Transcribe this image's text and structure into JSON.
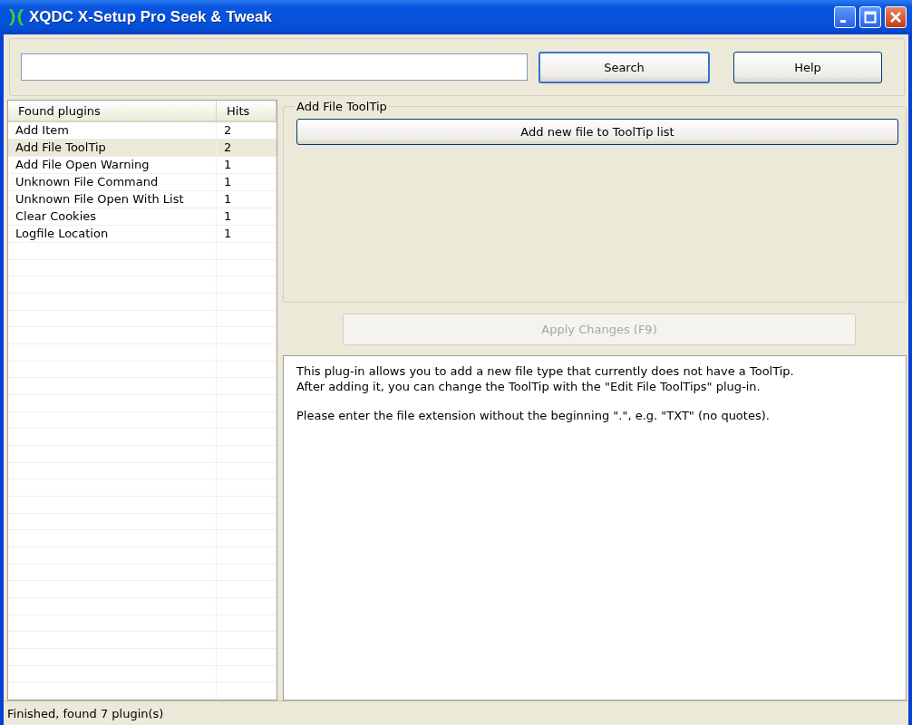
{
  "window": {
    "title": "XQDC X-Setup Pro Seek & Tweak"
  },
  "buttons": [
    {
      "label": "Search",
      "default": true
    },
    {
      "label": "Help",
      "default": false
    }
  ],
  "list": {
    "columns": [
      "Found plugins",
      "Hits"
    ],
    "rows": [
      {
        "name": "Add Item",
        "hits": "2",
        "selected": false
      },
      {
        "name": "Add File ToolTip",
        "hits": "2",
        "selected": true
      },
      {
        "name": "Add File Open Warning",
        "hits": "1",
        "selected": false
      },
      {
        "name": "Unknown File Command",
        "hits": "1",
        "selected": false
      },
      {
        "name": "Unknown File Open With List",
        "hits": "1",
        "selected": false
      },
      {
        "name": "Clear Cookies",
        "hits": "1",
        "selected": false
      },
      {
        "name": "Logfile Location",
        "hits": "1",
        "selected": false
      }
    ]
  },
  "plugin_group": {
    "title": "Add File ToolTip",
    "button": "Add new file to ToolTip list"
  },
  "apply_button": {
    "label": "Apply Changes (F9)",
    "disabled": true
  },
  "description": [
    "This plug-in allows you to add a new file type that currently does not have a ToolTip.\nAfter adding it, you can change the ToolTip with the \"Edit File ToolTips\" plug-in.",
    "Please enter the file extension without the beginning \".\", e.g. \"TXT\" (no quotes)."
  ],
  "status_bar": "Finished, found 7 plugin(s)"
}
